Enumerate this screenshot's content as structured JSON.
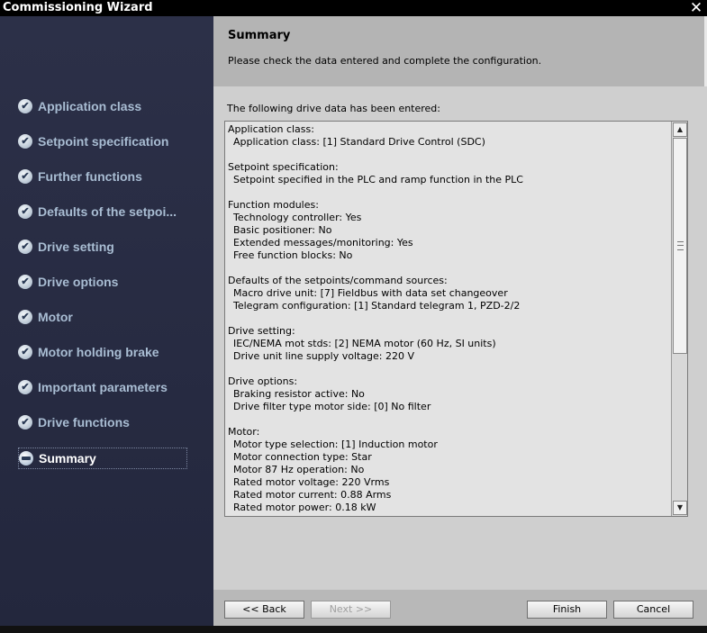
{
  "window": {
    "title": "Commissioning Wizard"
  },
  "sidebar": {
    "items": [
      {
        "label": "Application class",
        "state": "done"
      },
      {
        "label": "Setpoint specification",
        "state": "done"
      },
      {
        "label": "Further functions",
        "state": "done"
      },
      {
        "label": "Defaults of the setpoi...",
        "state": "done"
      },
      {
        "label": "Drive setting",
        "state": "done"
      },
      {
        "label": "Drive options",
        "state": "done"
      },
      {
        "label": "Motor",
        "state": "done"
      },
      {
        "label": "Motor holding brake",
        "state": "done"
      },
      {
        "label": "Important parameters",
        "state": "done"
      },
      {
        "label": "Drive functions",
        "state": "done"
      },
      {
        "label": "Summary",
        "state": "current"
      }
    ]
  },
  "header": {
    "title": "Summary",
    "description": "Please check the data entered and complete the configuration."
  },
  "summary": {
    "intro": "The following drive data has been entered:",
    "sections": [
      {
        "heading": "Application class:",
        "lines": [
          "Application class: [1] Standard Drive Control (SDC)"
        ]
      },
      {
        "heading": "Setpoint specification:",
        "lines": [
          "Setpoint specified in the PLC and ramp function in the PLC"
        ]
      },
      {
        "heading": "Function modules:",
        "lines": [
          "Technology controller: Yes",
          "Basic positioner: No",
          "Extended messages/monitoring: Yes",
          "Free function blocks: No"
        ]
      },
      {
        "heading": "Defaults of the setpoints/command sources:",
        "lines": [
          "Macro drive unit: [7] Fieldbus with data set changeover",
          "Telegram configuration: [1] Standard telegram 1, PZD-2/2"
        ]
      },
      {
        "heading": "Drive setting:",
        "lines": [
          "IEC/NEMA mot stds: [2] NEMA motor (60 Hz, SI units)",
          "Drive unit line supply voltage: 220 V"
        ]
      },
      {
        "heading": "Drive options:",
        "lines": [
          "Braking resistor active: No",
          "Drive filter type motor side: [0] No filter"
        ]
      },
      {
        "heading": "Motor:",
        "lines": [
          "Motor type selection: [1] Induction motor",
          "Motor connection type: Star",
          "Motor 87 Hz operation: No",
          "Rated motor voltage: 220 Vrms",
          "Rated motor current: 0.88 Arms",
          "Rated motor power: 0.18 kW"
        ]
      }
    ]
  },
  "buttons": {
    "back": "<< Back",
    "next": ">>",
    "next_prefix": "Next",
    "finish": "Finish",
    "cancel": "Cancel"
  },
  "icons": {
    "done": "check-circle-icon",
    "current": "current-step-icon",
    "close": "close-icon"
  }
}
